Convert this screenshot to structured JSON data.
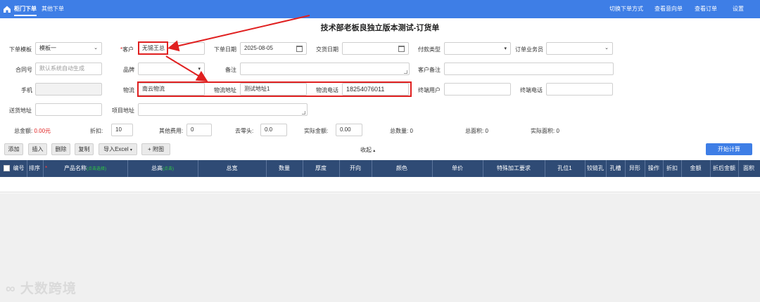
{
  "topbar": {
    "tabs": [
      "柜门下单",
      "其他下单"
    ],
    "right_links": [
      "切换下单方式",
      "查看意向单",
      "查看订单",
      "设置"
    ]
  },
  "form": {
    "title": "技术部老板良独立版本测试-订货单",
    "template_label": "下单模板",
    "template_value": "模板一",
    "customer_label": "客户",
    "customer_value": "无锡王总",
    "order_date_label": "下单日期",
    "order_date_value": "2025-08-05",
    "delivery_date_label": "交货日期",
    "payment_type_label": "付款类型",
    "salesperson_label": "订单业务员",
    "contract_label": "合同号",
    "contract_placeholder": "默认系统自动生成",
    "brand_label": "品牌",
    "remark_label": "备注",
    "customer_remark_label": "客户备注",
    "phone_label": "手机",
    "logistics_label": "物流",
    "logistics_value": "南云物流",
    "logistics_address_label": "物流地址",
    "logistics_address_value": "测试地址1",
    "logistics_phone_label": "物流电话",
    "logistics_phone_value": "18254076011",
    "end_user_label": "终端用户",
    "end_phone_label": "终端电话",
    "delivery_address_label": "送货地址",
    "project_address_label": "项目地址"
  },
  "summary": {
    "total_amount_label": "总金额:",
    "total_amount_value": "0.00元",
    "discount_label": "折扣:",
    "discount_value": "10",
    "other_fee_label": "其他费用:",
    "other_fee_value": "0",
    "round_label": "去零头:",
    "round_value": "0.0",
    "actual_amount_label": "实际金额:",
    "actual_amount_value": "0.00",
    "total_qty_label": "总数量:",
    "total_qty_value": "0",
    "total_area_label": "总面积:",
    "total_area_value": "0",
    "actual_area_label": "实际面积:",
    "actual_area_value": "0"
  },
  "toolbar": {
    "add": "添加",
    "insert": "插入",
    "delete": "删除",
    "copy": "复制",
    "import_excel": "导入Excel",
    "attach": "附图",
    "collapse": "收起",
    "start_calc": "开始计算"
  },
  "table": {
    "columns": [
      "编号",
      "排序",
      "产品名称",
      "(点击选择)",
      "总高",
      "(点击)",
      "总宽",
      "数量",
      "厚度",
      "开向",
      "颜色",
      "单价",
      "特殊加工要求",
      "孔位1",
      "铰链孔",
      "孔槽",
      "异形",
      "操作",
      "折扣",
      "金额",
      "折后金额",
      "面积"
    ]
  },
  "watermark": "大数跨境",
  "colors": {
    "brand_blue": "#3e7ee6",
    "table_header": "#2f4b75",
    "highlight_red": "#e02020",
    "hint_green": "#2ecc40"
  }
}
